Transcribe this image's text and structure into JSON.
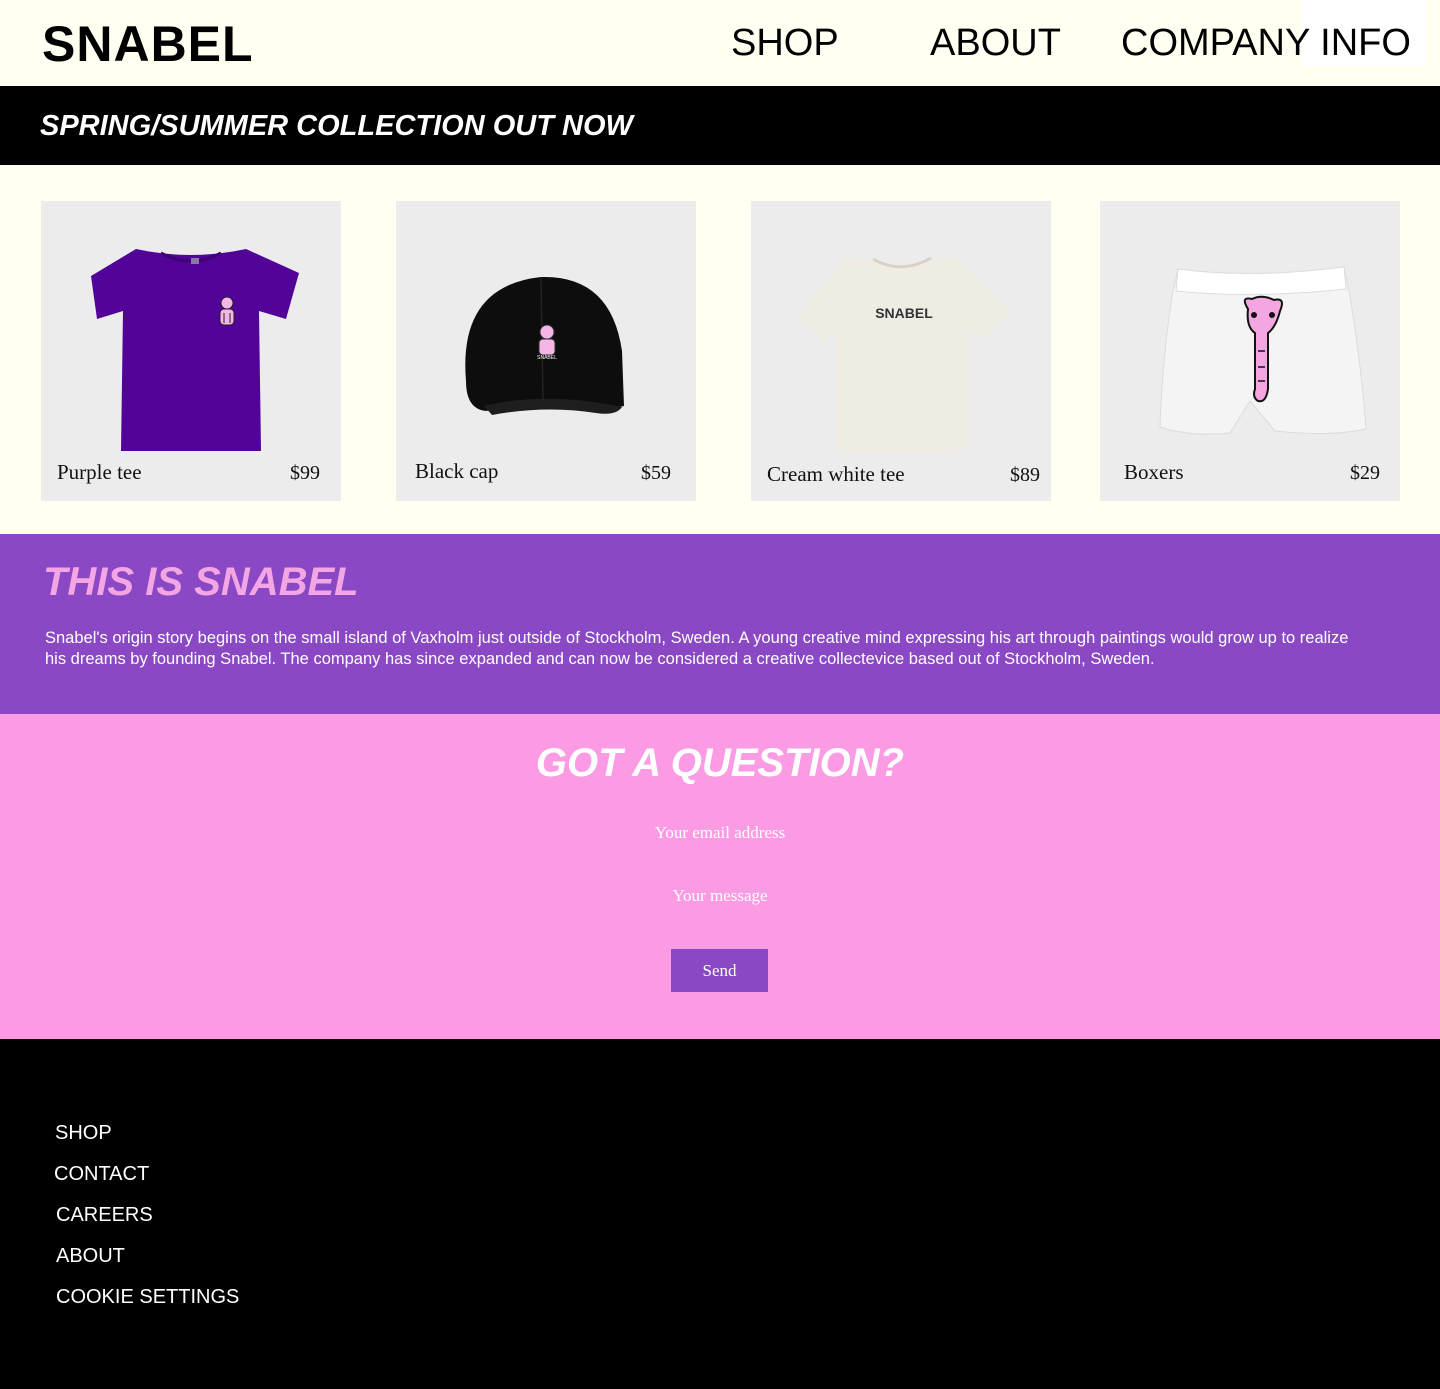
{
  "header": {
    "logo": "SNABEL",
    "nav": [
      "SHOP",
      "ABOUT",
      "COMPANY INFO"
    ]
  },
  "banner": {
    "text": "SPRING/SUMMER COLLECTION OUT NOW"
  },
  "products": [
    {
      "name": "Purple tee",
      "price": "$99",
      "image": "purple-tshirt-with-pink-figure",
      "color": "#520499"
    },
    {
      "name": "Black cap",
      "price": "$59",
      "image": "black-cap-with-pink-figure",
      "color": "#0d0d0d",
      "logo_text": "SNABEL"
    },
    {
      "name": "Cream white tee",
      "price": "$89",
      "image": "cream-tshirt-with-snabel-text",
      "color": "#efece4",
      "print_text": "SNABEL"
    },
    {
      "name": "Boxers",
      "price": "$29",
      "image": "white-boxers-with-pink-elephant",
      "color": "#f4f4f4"
    }
  ],
  "about": {
    "title": "THIS IS SNABEL",
    "text": "Snabel's origin story begins on the small island of Vaxholm just outside of Stockholm, Sweden. A young creative mind expressing his art through paintings would grow up to realize his dreams by founding Snabel. The company has since expanded and can now be considered a creative collectevice based out of Stockholm, Sweden."
  },
  "contact": {
    "title": "GOT A QUESTION?",
    "email_placeholder": "Your email address",
    "message_placeholder": "Your message",
    "send_label": "Send"
  },
  "footer": {
    "links": [
      "SHOP",
      "CONTACT",
      "CAREERS",
      "ABOUT",
      "COOKIE SETTINGS"
    ]
  },
  "colors": {
    "cream": "#fffff2",
    "purple": "#8a48c4",
    "pink": "#fb9be3",
    "title_pink": "#f4a6e4",
    "black": "#000000"
  }
}
